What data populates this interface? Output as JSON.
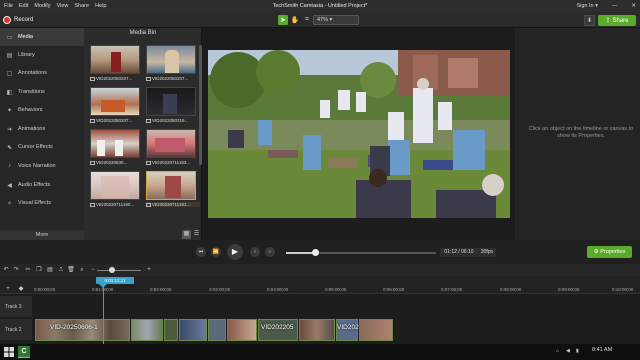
{
  "window": {
    "title": "TechSmith Camtasia - Untitled Project*",
    "menu": [
      "File",
      "Edit",
      "Modify",
      "View",
      "Share",
      "Help"
    ],
    "sign_in": "Sign In ▾",
    "minimize": "—",
    "close": "✕"
  },
  "toolbar": {
    "record_label": "Record",
    "zoom_value": "47%",
    "share_label": "Share",
    "download_glyph": "⬇"
  },
  "sidebar": {
    "items": [
      {
        "label": "Media",
        "icon": "film-icon"
      },
      {
        "label": "Library",
        "icon": "library-icon"
      },
      {
        "label": "Annotations",
        "icon": "annotation-icon"
      },
      {
        "label": "Transitions",
        "icon": "transition-icon"
      },
      {
        "label": "Behaviors",
        "icon": "behavior-icon"
      },
      {
        "label": "Animations",
        "icon": "animation-icon"
      },
      {
        "label": "Cursor Effects",
        "icon": "cursor-icon"
      },
      {
        "label": "Voice Narration",
        "icon": "microphone-icon"
      },
      {
        "label": "Audio Effects",
        "icon": "speaker-icon"
      },
      {
        "label": "Visual Effects",
        "icon": "visual-effects-icon"
      }
    ],
    "more_label": "More",
    "add_glyph": "+"
  },
  "media_bin": {
    "title": "Media Bin",
    "items": [
      {
        "label": "VID2022050207..."
      },
      {
        "label": "VID2022050207..."
      },
      {
        "label": "VID2022050207..."
      },
      {
        "label": "VID2022050219..."
      },
      {
        "label": "VID20220530..."
      },
      {
        "label": "VID20220711183..."
      },
      {
        "label": "VID20220711190..."
      },
      {
        "label": "VID20220711191..."
      }
    ]
  },
  "properties_panel": {
    "hint": "Click an object on the timeline or canvas to show its Properties."
  },
  "playback": {
    "timecode": "01:12 / 06:10",
    "fps": "30fps",
    "properties_label": "Properties",
    "progress": 0.195
  },
  "timeline": {
    "playhead_time": "0:01:12;11",
    "ticks": [
      "0:00:00;00",
      "0:01:00;00",
      "0:02:00;00",
      "0:03:00;00",
      "0:04:00;00",
      "0:05:00;00",
      "0:06:00;00",
      "0:07:00;00",
      "0:08:00;00",
      "0:09:00;00",
      "0:10:00;00"
    ],
    "tracks": [
      {
        "label": "Track 3"
      },
      {
        "label": "Track 2"
      }
    ],
    "clip_labels": [
      "VID-20250606-1",
      "VID202205",
      "VID202"
    ],
    "zoom_level": 0.35
  },
  "taskbar": {
    "time": "8:41 AM",
    "app_glyph": "C"
  }
}
